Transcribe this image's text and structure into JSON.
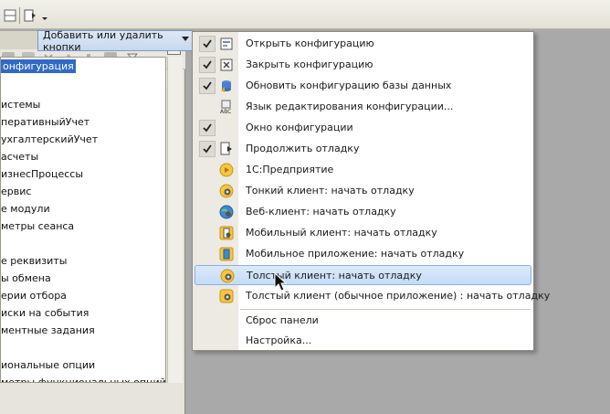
{
  "toolbar": {
    "add_remove_label": "Добавить или удалить кнопки"
  },
  "tree": {
    "items": [
      {
        "label": "онфигурация",
        "selected": true
      },
      {
        "label": ""
      },
      {
        "label": "истемы"
      },
      {
        "label": "перативныйУчет"
      },
      {
        "label": "ухгалтерскийУчет"
      },
      {
        "label": "асчеты"
      },
      {
        "label": "изнесПроцессы"
      },
      {
        "label": "ервис"
      },
      {
        "label": "е модули"
      },
      {
        "label": "метры сеанса"
      },
      {
        "label": ""
      },
      {
        "label": "е реквизиты"
      },
      {
        "label": "ы обмена"
      },
      {
        "label": "ерии отбора"
      },
      {
        "label": "иски на события"
      },
      {
        "label": "ментные задания"
      },
      {
        "label": ""
      },
      {
        "label": "иональные опции"
      },
      {
        "label": "метры функциональных опций"
      }
    ]
  },
  "menu": {
    "items": [
      {
        "label": "Открыть конфигурацию",
        "checked": true,
        "icon": "open-config-icon"
      },
      {
        "label": "Закрыть конфигурацию",
        "checked": true,
        "icon": "close-config-icon"
      },
      {
        "label": "Обновить конфигурацию базы данных",
        "checked": true,
        "icon": "update-db-icon"
      },
      {
        "label": "Язык редактирования конфигурации...",
        "checked": false,
        "icon": "abc-language-icon"
      },
      {
        "label": "Окно конфигурации",
        "checked": true,
        "icon": "config-window-icon"
      },
      {
        "label": "Продолжить отладку",
        "checked": true,
        "icon": "continue-debug-icon"
      },
      {
        "label": "1С:Предприятие",
        "checked": false,
        "icon": "enterprise-run-icon"
      },
      {
        "label": "Тонкий клиент: начать отладку",
        "checked": false,
        "icon": "thin-client-icon"
      },
      {
        "label": "Веб-клиент: начать отладку",
        "checked": false,
        "icon": "web-client-icon"
      },
      {
        "label": "Мобильный клиент: начать отладку",
        "checked": false,
        "icon": "mobile-client-icon"
      },
      {
        "label": "Мобильное приложение: начать отладку",
        "checked": false,
        "icon": "mobile-app-icon"
      },
      {
        "label": "Толстый клиент: начать отладку",
        "checked": false,
        "icon": "thick-client-icon",
        "hover": true
      },
      {
        "label": "Толстый клиент (обычное приложение) : начать отладку",
        "checked": false,
        "icon": "thick-client-ordinary-icon"
      }
    ],
    "reset_label": "Сброс панели",
    "settings_label": "Настройка..."
  },
  "colors": {
    "selection": "#316ac5",
    "menu_hover": "#c5dbf7",
    "gutter": "#eceae3"
  }
}
